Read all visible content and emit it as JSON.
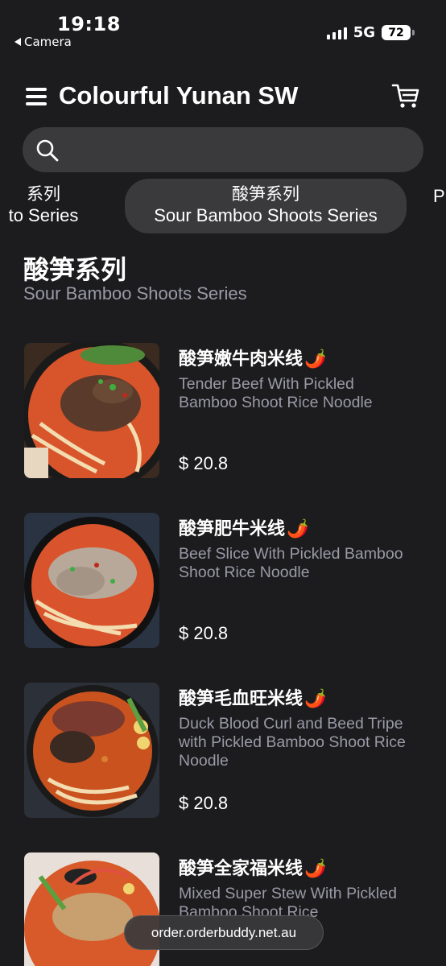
{
  "status_bar": {
    "time": "19:18",
    "back_app": "Camera",
    "network": "5G",
    "battery": "72"
  },
  "header": {
    "title": "Colourful Yunan SW",
    "menu_icon": "hamburger-menu-icon",
    "cart_icon": "shopping-cart-icon"
  },
  "search": {
    "placeholder": "",
    "value": "",
    "icon": "search-icon"
  },
  "tabs": [
    {
      "zh": "系列",
      "en": "to Series",
      "active": false
    },
    {
      "zh": "酸笋系列",
      "en": "Sour Bamboo Shoots Series",
      "active": true
    },
    {
      "zh": "",
      "en": "P",
      "active": false
    }
  ],
  "section": {
    "title": "酸笋系列",
    "subtitle": "Sour Bamboo Shoots Series"
  },
  "items": [
    {
      "name": "酸笋嫩牛肉米线",
      "chili": "🌶️",
      "desc": "Tender Beef With Pickled Bamboo Shoot Rice Noodle",
      "price": "$ 20.8"
    },
    {
      "name": "酸笋肥牛米线",
      "chili": "🌶️",
      "desc": "Beef Slice With Pickled Bamboo Shoot Rice Noodle",
      "price": "$ 20.8"
    },
    {
      "name": "酸笋毛血旺米线",
      "chili": "🌶️",
      "desc": "Duck Blood Curl and Beed Tripe with Pickled Bamboo Shoot Rice Noodle",
      "price": "$ 20.8"
    },
    {
      "name": "酸笋全家福米线",
      "chili": "🌶️",
      "desc": "Mixed Super Stew With Pickled Bamboo Shoot Rice",
      "price": ""
    }
  ],
  "url_bar": {
    "url": "order.orderbuddy.net.au"
  },
  "colors": {
    "background": "#1c1c1e",
    "pill": "#3a3a3c",
    "muted_text": "#9a9aa8"
  }
}
